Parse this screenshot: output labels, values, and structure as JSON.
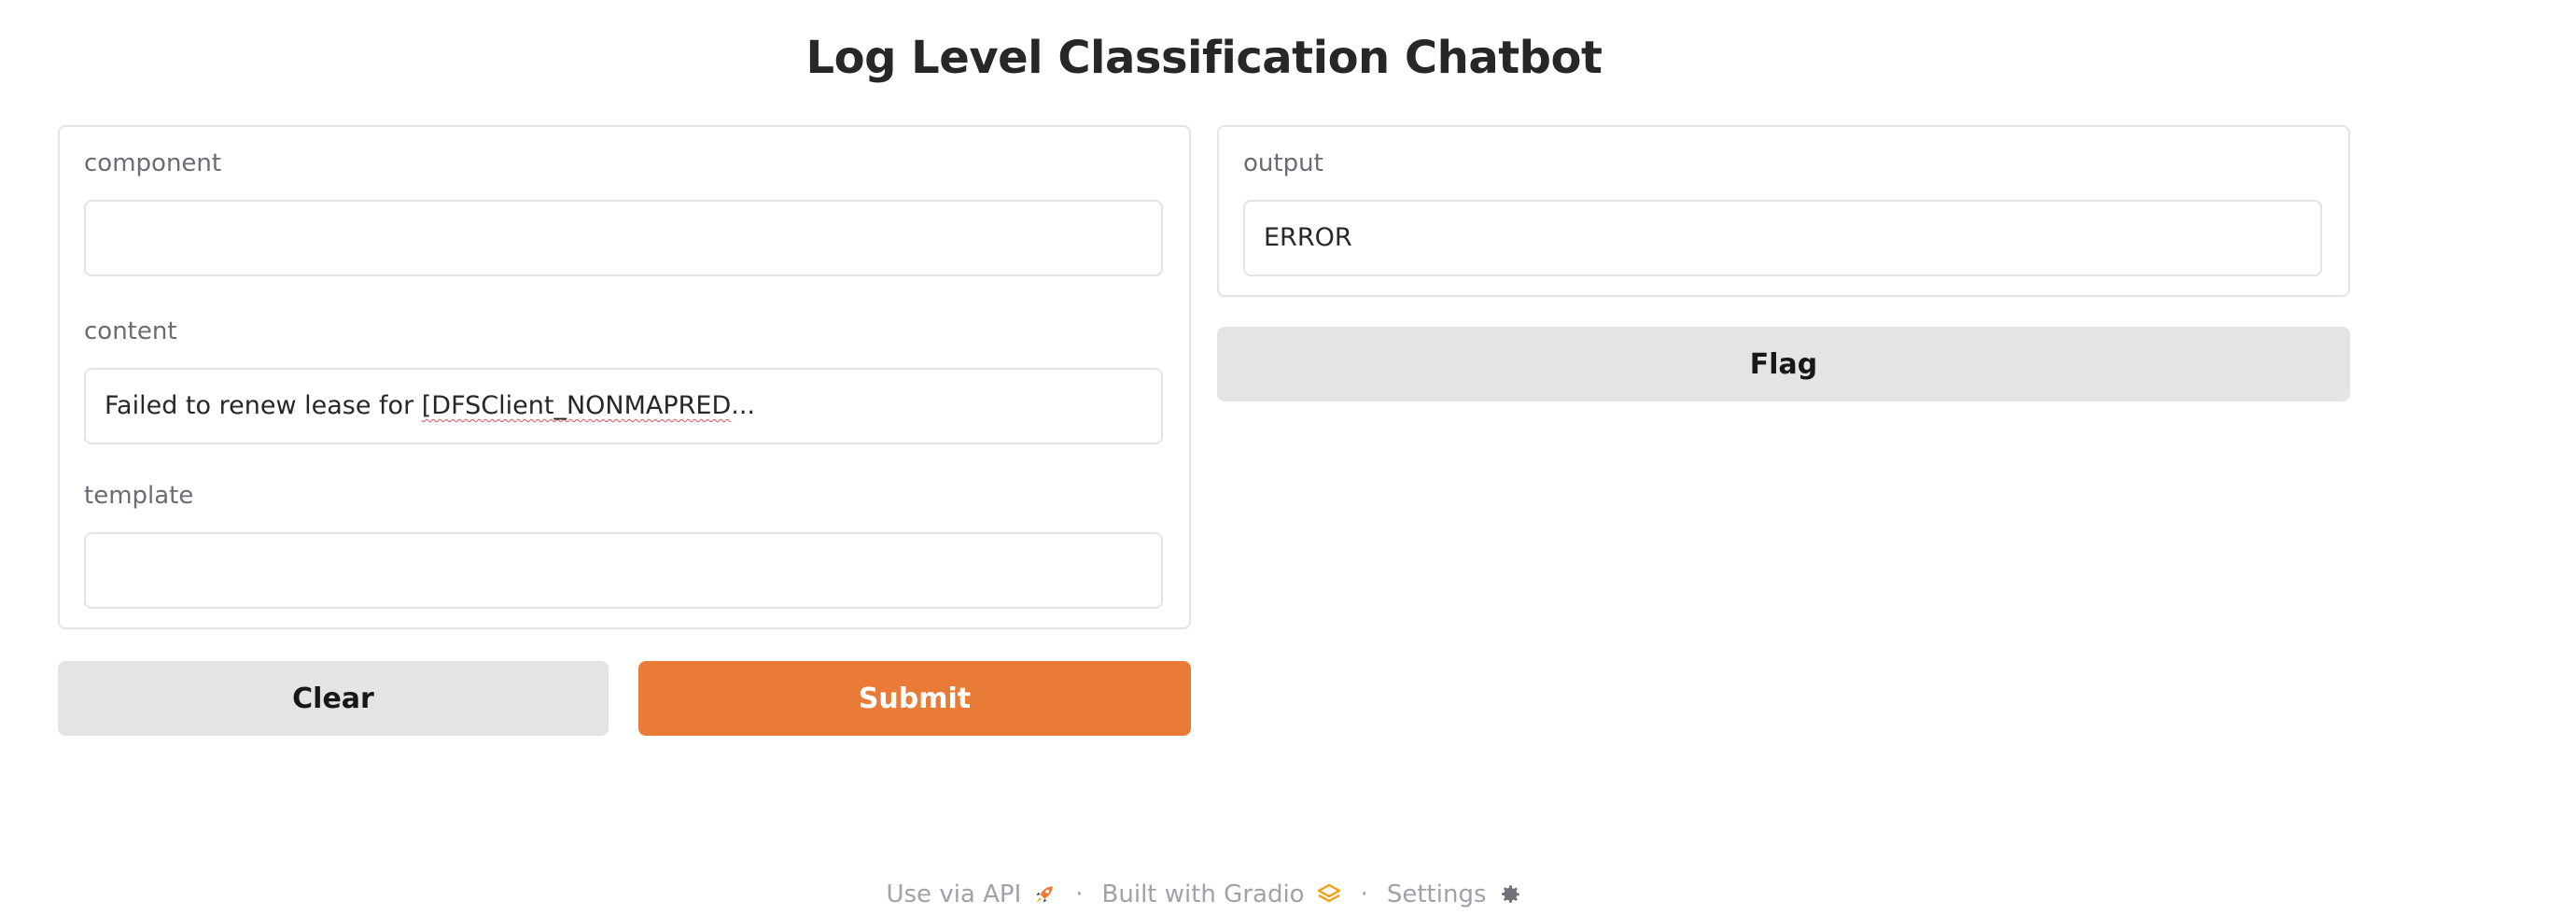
{
  "app": {
    "title": "Log Level Classification Chatbot"
  },
  "inputs": {
    "component": {
      "label": "component",
      "value": ""
    },
    "content": {
      "label": "content",
      "value_prefix": "Failed to renew lease for ",
      "value_marked": "[DFSClient_NONMAPRED",
      "value_suffix": "..."
    },
    "template": {
      "label": "template",
      "value": ""
    }
  },
  "output": {
    "label": "output",
    "value": "ERROR"
  },
  "buttons": {
    "clear": "Clear",
    "submit": "Submit",
    "flag": "Flag"
  },
  "footer": {
    "api": "Use via API",
    "built": "Built with Gradio",
    "settings": "Settings",
    "separator": "·"
  },
  "colors": {
    "primary": "#e97b36",
    "secondary": "#e4e4e7",
    "border": "#e4e4e7"
  },
  "icons": {
    "api": "rocket-icon",
    "gradio": "gradio-logo-icon",
    "settings": "gear-icon"
  }
}
